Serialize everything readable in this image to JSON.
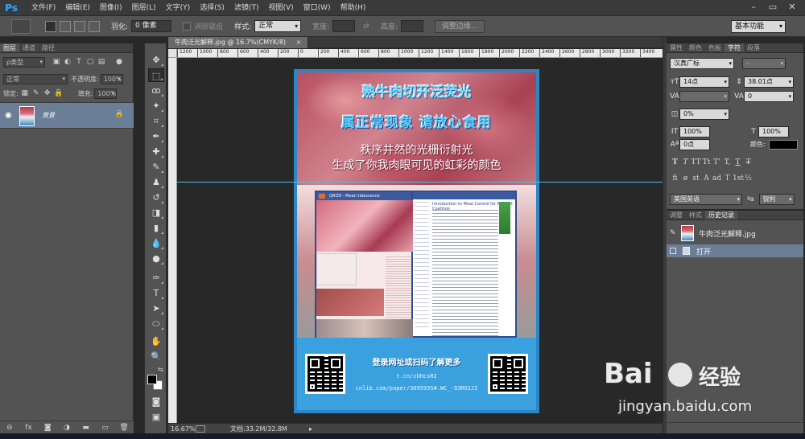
{
  "app": {
    "logo": "Ps"
  },
  "menu": [
    "文件(F)",
    "编辑(E)",
    "图像(I)",
    "图层(L)",
    "文字(Y)",
    "选择(S)",
    "滤镜(T)",
    "视图(V)",
    "窗口(W)",
    "帮助(H)"
  ],
  "window_controls": [
    "–",
    "▭",
    "✕"
  ],
  "options": {
    "feather_label": "羽化:",
    "feather_value": "0 像素",
    "antialias_label": "消除锯齿",
    "style_label": "样式:",
    "style_value": "正常",
    "width_label": "宽度:",
    "height_label": "高度:",
    "refine_edge": "调整边缘...",
    "workspace": "基本功能"
  },
  "layers_panel": {
    "tabs": [
      "图层",
      "通道",
      "路径"
    ],
    "filter_kind": "ρ类型",
    "blend_mode": "正常",
    "opacity_label": "不透明度:",
    "opacity_value": "100%",
    "lock_label": "锁定:",
    "fill_label": "填充:",
    "fill_value": "100%",
    "layer_name": "背景"
  },
  "document": {
    "tab_title": "牛肉泛光解释.jpg @ 16.7%(CMYK/8)",
    "close": "×",
    "ruler_labels": [
      "1200",
      "1000",
      "800",
      "600",
      "400",
      "200",
      "0",
      "200",
      "400",
      "600",
      "800",
      "1000",
      "1200",
      "1400",
      "1600",
      "1800",
      "2000",
      "2200",
      "2400",
      "2600",
      "2800",
      "3000",
      "3200",
      "3400"
    ],
    "zoom": "16.67%",
    "doc_size": "文档:33.2M/32.8M",
    "status_arrow": "▸"
  },
  "poster": {
    "title1": "熟牛肉切开泛荧光",
    "title2": "属正常现象 请放心食用",
    "line1": "秩序井然的光栅衍射光",
    "line2": "生成了你我肉眼可见的虹彩的颜色",
    "paper_left_header": "QROD - Meat iridescence",
    "paper_right_title": "Introduction to Meat Control for Radiant Coatings",
    "cta": "登录网址或扫码了解更多",
    "url1": "t.cn/zOHcsRI",
    "url2": "cnlib.com/paper/3095935#.WC_-93RO2JI"
  },
  "character_panel": {
    "tabs": [
      "属性",
      "颜色",
      "色板",
      "字符",
      "段落"
    ],
    "font_family": "汉真广标",
    "font_style": "-",
    "font_size": "14点",
    "leading": "38.01点",
    "kerning": "",
    "tracking": "0",
    "scale_percent": "0%",
    "vertical_scale": "100%",
    "horizontal_scale": "100%",
    "baseline_shift": "0点",
    "color_label": "颜色:",
    "type_styles": [
      "T",
      "T",
      "TT",
      "Tt",
      "T'",
      "T,",
      "T",
      "T"
    ],
    "opentype": [
      "fi",
      "ø",
      "st",
      "A",
      "ad",
      "T",
      "1st",
      "½"
    ],
    "language": "美国英语",
    "aa_label": "ªa",
    "antialias": "锐利"
  },
  "history_panel": {
    "tabs": [
      "调整",
      "样式",
      "历史记录"
    ],
    "snapshot_name": "牛肉泛光解释.jpg",
    "state_open": "打开"
  },
  "watermark": {
    "logo": "Bai",
    "logo_suffix": "经验",
    "url": "jingyan.baidu.com"
  },
  "colors": {
    "accent": "#31a8ff",
    "selected_layer": "#6a7f97",
    "guide": "#3fc7e8"
  }
}
